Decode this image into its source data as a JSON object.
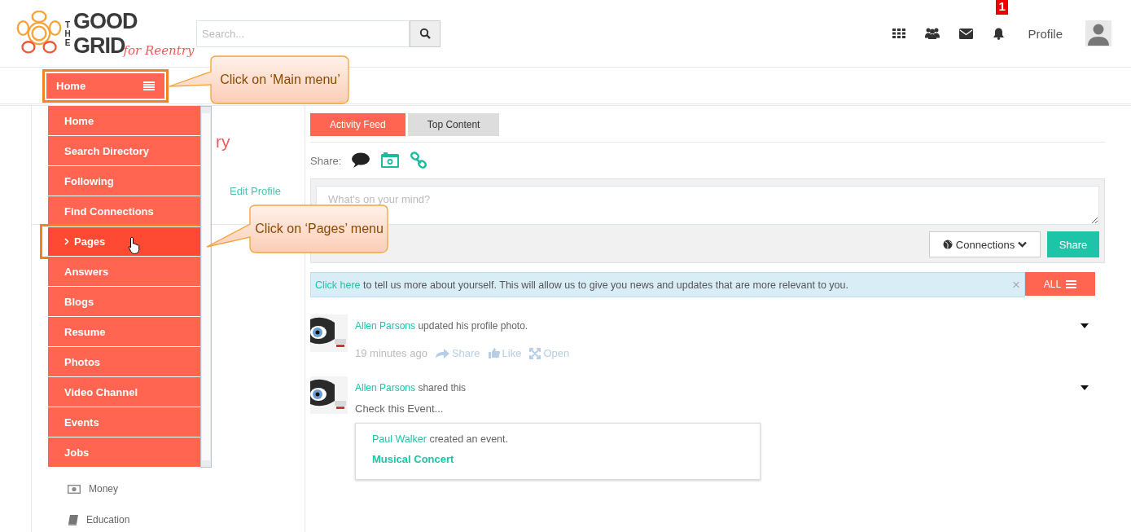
{
  "header": {
    "logo": {
      "the": "THE",
      "good": "GOOD",
      "grid": "GRID",
      "tagline": "for Reentry"
    },
    "search": {
      "placeholder": "Search..."
    },
    "notification_count": "1",
    "profile": "Profile"
  },
  "main_menu_button": {
    "label": "Home",
    "callout": "Click on ‘Main menu’"
  },
  "menu": {
    "items": [
      {
        "label": "Home",
        "selected": false
      },
      {
        "label": "Search Directory",
        "selected": false
      },
      {
        "label": "Following",
        "selected": false
      },
      {
        "label": "Find Connections",
        "selected": false
      },
      {
        "label": "Pages",
        "selected": true
      },
      {
        "label": "Answers",
        "selected": false
      },
      {
        "label": "Blogs",
        "selected": false
      },
      {
        "label": "Resume",
        "selected": false
      },
      {
        "label": "Photos",
        "selected": false
      },
      {
        "label": "Video Channel",
        "selected": false
      },
      {
        "label": "Events",
        "selected": false
      },
      {
        "label": "Jobs",
        "selected": false
      }
    ],
    "callout": "Click on ‘Pages’ menu"
  },
  "profile_card": {
    "name_fragment": "ry",
    "edit_link": "Edit Profile"
  },
  "sidebar": {
    "items": [
      {
        "label": "Money"
      },
      {
        "label": "Education"
      }
    ]
  },
  "feed": {
    "tabs": [
      {
        "label": "Activity Feed",
        "selected": true
      },
      {
        "label": "Top Content",
        "selected": false
      }
    ],
    "share_label": "Share:",
    "post_placeholder": "What's on your mind?",
    "audience": "Connections",
    "share_button": "Share",
    "notice": {
      "link": "Click here",
      "text": "to tell us more about yourself. This will allow us to give you news and updates that are more relevant to you.",
      "close": "×"
    },
    "filter": "ALL",
    "posts": [
      {
        "author": "Allen Parsons",
        "action": "updated his profile photo.",
        "time": "19 minutes ago",
        "actions": [
          "Share",
          "Like",
          "Open"
        ]
      },
      {
        "author": "Allen Parsons",
        "action": "shared this",
        "body": "Check this Event...",
        "embed": {
          "author": "Paul Walker",
          "action": "created an event.",
          "title": "Musical Concert"
        }
      }
    ]
  }
}
